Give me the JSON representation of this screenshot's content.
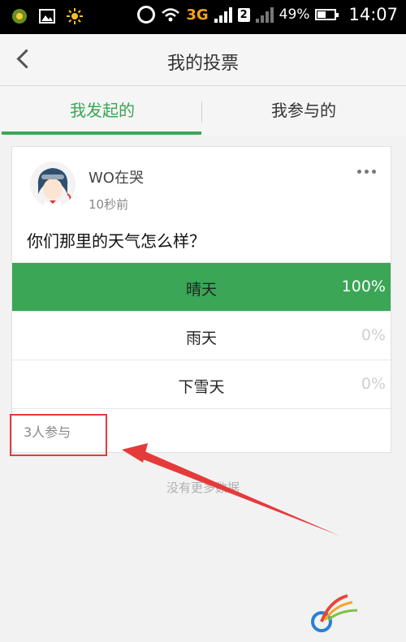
{
  "status_bar": {
    "network": "3G",
    "sim_badge": "2",
    "battery": "49%",
    "time": "14:07"
  },
  "header": {
    "title": "我的投票"
  },
  "tabs": [
    {
      "label": "我发起的",
      "active": true
    },
    {
      "label": "我参与的",
      "active": false
    }
  ],
  "poll": {
    "author": "WO在哭",
    "time_ago": "10秒前",
    "question": "你们那里的天气怎么样？",
    "options": [
      {
        "label": "晴天",
        "percent_text": "100%",
        "percent": 100
      },
      {
        "label": "雨天",
        "percent_text": "0%",
        "percent": 0
      },
      {
        "label": "下雪天",
        "percent_text": "0%",
        "percent": 0
      }
    ],
    "participants": "3人参与"
  },
  "footer": {
    "no_more": "没有更多数据"
  },
  "colors": {
    "accent": "#3aa656",
    "annotation": "#e53a3a"
  }
}
